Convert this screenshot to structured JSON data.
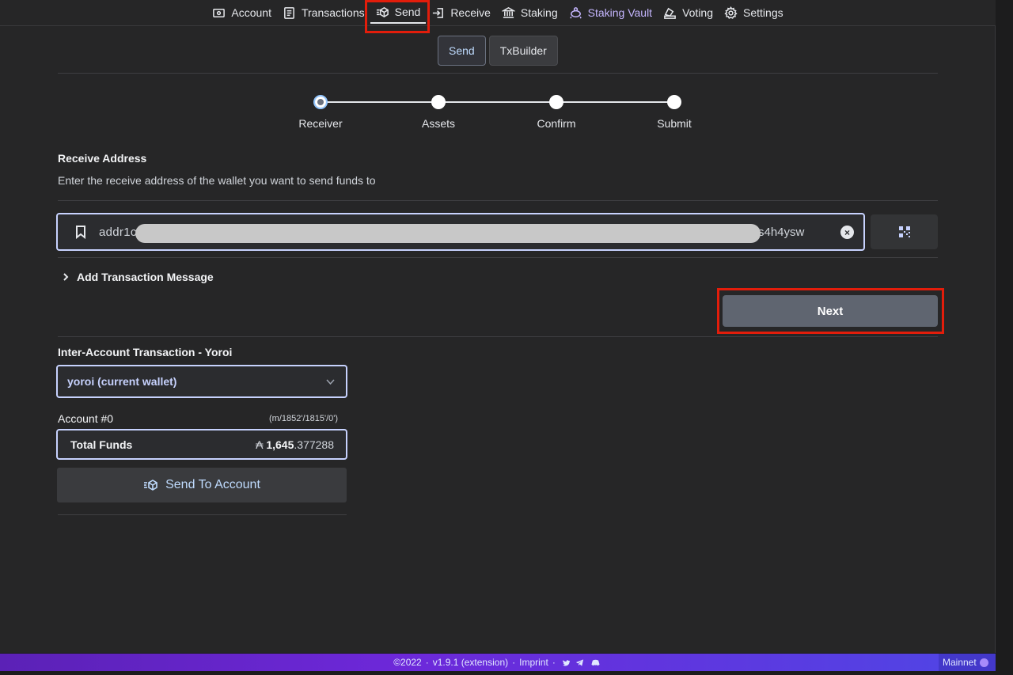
{
  "nav": {
    "items": [
      {
        "label": "Account",
        "icon": "wallet-icon"
      },
      {
        "label": "Transactions",
        "icon": "list-icon"
      },
      {
        "label": "Send",
        "icon": "send-icon"
      },
      {
        "label": "Receive",
        "icon": "receive-icon"
      },
      {
        "label": "Staking",
        "icon": "bank-icon"
      },
      {
        "label": "Staking Vault",
        "icon": "vault-icon"
      },
      {
        "label": "Voting",
        "icon": "vote-icon"
      },
      {
        "label": "Settings",
        "icon": "gear-icon"
      }
    ],
    "active": "Send"
  },
  "subtabs": {
    "send": "Send",
    "txbuilder": "TxBuilder"
  },
  "stepper": {
    "steps": [
      "Receiver",
      "Assets",
      "Confirm",
      "Submit"
    ],
    "current": 0
  },
  "receive": {
    "title": "Receive Address",
    "description": "Enter the receive address of the wallet you want to send funds to",
    "address_start": "addr1c",
    "address_end": "s4h4ysw"
  },
  "tx_message": {
    "label": "Add Transaction Message"
  },
  "next_button": "Next",
  "inter_account": {
    "title": "Inter-Account Transaction - Yoroi",
    "wallet_selected": "yoroi (current wallet)",
    "account_label": "Account #0",
    "account_path": "(m/1852'/1815'/0')",
    "funds_label": "Total Funds",
    "funds_symbol": "₳",
    "funds_int": "1,645",
    "funds_dec": ".377288",
    "send_button": "Send To Account"
  },
  "footer": {
    "copyright": "©2022",
    "version": "v1.9.1 (extension)",
    "imprint": "Imprint",
    "network": "Mainnet"
  },
  "colors": {
    "accent": "#c7d2fe",
    "highlight": "#e21d0b",
    "footer": "#6d28d9"
  }
}
